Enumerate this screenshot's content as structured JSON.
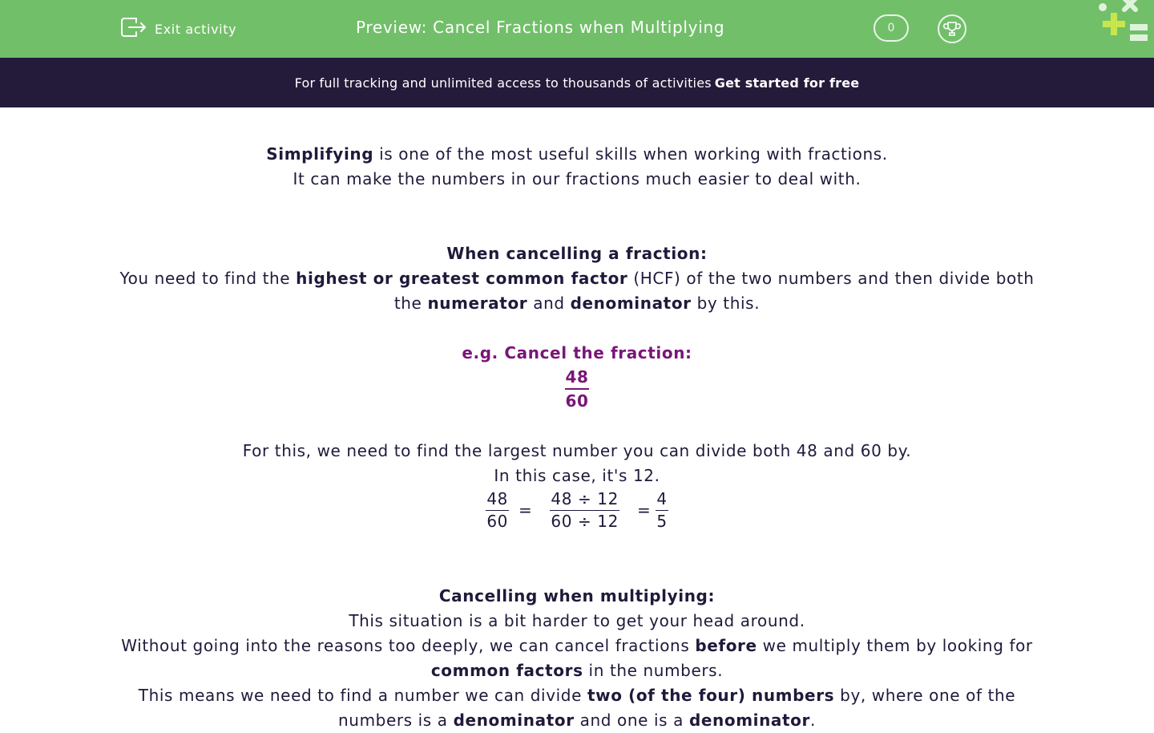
{
  "header": {
    "exit_label": "Exit activity",
    "title": "Preview: Cancel Fractions when Multiplying",
    "score": "0"
  },
  "banner": {
    "text": "For full tracking and unlimited access to thousands of activities",
    "cta": "Get started for free"
  },
  "intro": {
    "line1_bold": "Simplifying",
    "line1_rest": " is one of the most useful skills when working with fractions.",
    "line2": "It can make the numbers in our fractions much easier to deal with."
  },
  "cancelling": {
    "heading": "When cancelling a fraction:",
    "p1_a": "You need to find the ",
    "p1_b": "highest or greatest common factor",
    "p1_c": " (HCF) of the two numbers and then divide both",
    "p2_a": "the ",
    "p2_b": "numerator",
    "p2_c": " and ",
    "p2_d": "denominator",
    "p2_e": " by this."
  },
  "example": {
    "heading": "e.g. Cancel the fraction:",
    "numerator": "48",
    "denominator": "60"
  },
  "explanation": {
    "line1": "For this, we need to find the largest number you can divide both 48 and 60 by.",
    "line2": "In this case, it's 12.",
    "eq": {
      "f1_num": "48",
      "f1_den": "60",
      "equals": "=",
      "f2_num": "48 ÷ 12",
      "f2_den": "60 ÷ 12",
      "f3_num": "4",
      "f3_den": "5"
    }
  },
  "multiplying": {
    "heading": "Cancelling when multiplying:",
    "line1": "This situation is a bit harder to get your head around.",
    "line2_a": "Without going into the reasons too deeply, we can cancel fractions ",
    "line2_b": "before",
    "line2_c": " we multiply them by looking for",
    "line3_a": "common factors",
    "line3_b": " in the numbers.",
    "line4_a": "This means we need to find a number we can divide ",
    "line4_b": "two (of the four) numbers",
    "line4_c": " by, where one of the",
    "line5_a": "numbers is a ",
    "line5_b": "denominator",
    "line5_c": " and one is a ",
    "line5_d": "denominator",
    "line5_e": "."
  },
  "colors": {
    "header_green": "#72bf6a",
    "banner_navy": "#241b3a",
    "example_purple": "#7a1579",
    "text": "#1f1a3a"
  }
}
